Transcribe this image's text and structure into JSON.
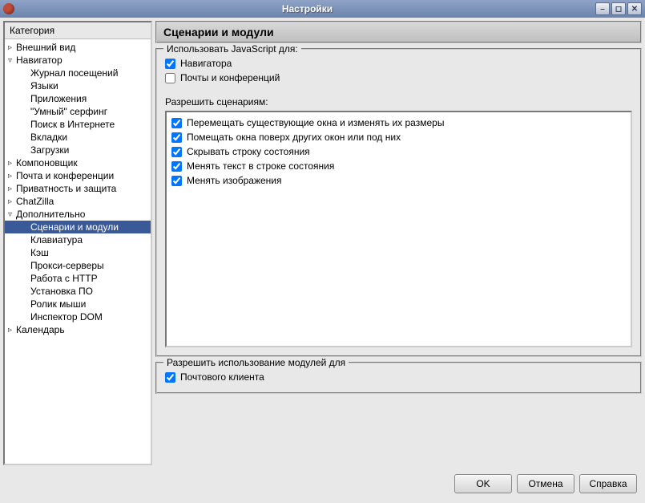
{
  "window": {
    "title": "Настройки"
  },
  "sidebar": {
    "title": "Категория",
    "items": [
      {
        "label": "Внешний вид",
        "indent": 0,
        "toggle": "▹"
      },
      {
        "label": "Навигатор",
        "indent": 0,
        "toggle": "▿"
      },
      {
        "label": "Журнал посещений",
        "indent": 1
      },
      {
        "label": "Языки",
        "indent": 1
      },
      {
        "label": "Приложения",
        "indent": 1
      },
      {
        "label": "\"Умный\" серфинг",
        "indent": 1
      },
      {
        "label": "Поиск в Интернете",
        "indent": 1
      },
      {
        "label": "Вкладки",
        "indent": 1
      },
      {
        "label": "Загрузки",
        "indent": 1
      },
      {
        "label": "Компоновщик",
        "indent": 0,
        "toggle": "▹"
      },
      {
        "label": "Почта и конференции",
        "indent": 0,
        "toggle": "▹"
      },
      {
        "label": "Приватность и защита",
        "indent": 0,
        "toggle": "▹"
      },
      {
        "label": "ChatZilla",
        "indent": 0,
        "toggle": "▹"
      },
      {
        "label": "Дополнительно",
        "indent": 0,
        "toggle": "▿"
      },
      {
        "label": "Сценарии и модули",
        "indent": 1,
        "selected": true
      },
      {
        "label": "Клавиатура",
        "indent": 1
      },
      {
        "label": "Кэш",
        "indent": 1
      },
      {
        "label": "Прокси-серверы",
        "indent": 1
      },
      {
        "label": "Работа с HTTP",
        "indent": 1
      },
      {
        "label": "Установка ПО",
        "indent": 1
      },
      {
        "label": "Ролик мыши",
        "indent": 1
      },
      {
        "label": "Инспектор DOM",
        "indent": 1
      },
      {
        "label": "Календарь",
        "indent": 0,
        "toggle": "▹"
      }
    ]
  },
  "panel": {
    "title": "Сценарии и модули",
    "group1": {
      "title": "Использовать JavaScript для:",
      "items": [
        {
          "label": "Навигатора",
          "checked": true
        },
        {
          "label": "Почты и конференций",
          "checked": false
        }
      ]
    },
    "scripts_label": "Разрешить сценариям:",
    "script_permissions": [
      {
        "label": "Перемещать существующие окна и изменять их размеры",
        "checked": true
      },
      {
        "label": "Помещать окна поверх других окон или под них",
        "checked": true
      },
      {
        "label": "Скрывать строку состояния",
        "checked": true
      },
      {
        "label": "Менять текст в строке состояния",
        "checked": true
      },
      {
        "label": "Менять изображения",
        "checked": true
      }
    ],
    "group3": {
      "title": "Разрешить использование модулей для",
      "items": [
        {
          "label": "Почтового клиента",
          "checked": true
        }
      ]
    }
  },
  "buttons": {
    "ok": "OK",
    "cancel": "Отмена",
    "help": "Справка"
  }
}
